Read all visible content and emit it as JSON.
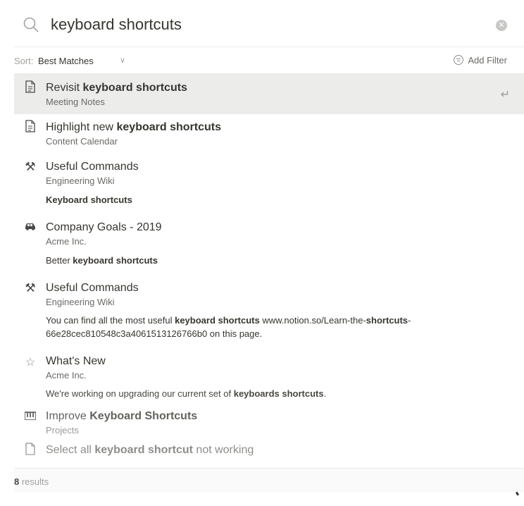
{
  "search": {
    "query": "keyboard shortcuts",
    "clear_icon": "clear-icon"
  },
  "sort": {
    "label": "Sort:",
    "value": "Best Matches",
    "chevron": "∨"
  },
  "filter": {
    "label": "Add Filter"
  },
  "results": [
    {
      "icon": "page-icon",
      "title_pre": "Revisit ",
      "title_bold": "keyboard shortcuts",
      "title_post": "",
      "subtitle": "Meeting Notes",
      "selected": true
    },
    {
      "icon": "page-icon",
      "title_pre": "Highlight new ",
      "title_bold": "keyboard shortcuts",
      "title_post": "",
      "subtitle": "Content Calendar"
    },
    {
      "icon": "hammer-wrench-icon",
      "title_pre": "Useful Commands",
      "subtitle": "Engineering Wiki",
      "snippet_bold": "Keyboard shortcuts"
    },
    {
      "icon": "car-icon",
      "title_pre": "Company Goals - 2019",
      "subtitle": "Acme Inc.",
      "snippet_pre": "Better ",
      "snippet_bold": "keyboard shortcuts"
    },
    {
      "icon": "hammer-wrench-icon",
      "title_pre": "Useful Commands",
      "subtitle": "Engineering Wiki",
      "snippet_pre": "You can find all the most useful ",
      "snippet_bold": "keyboard shortcuts",
      "snippet_mid": " www.notion.so/Learn-the-",
      "snippet_bold2": "shortcuts",
      "snippet_post": "-66e28cec810548c3a4061513126766b0 on this page."
    },
    {
      "icon": "star-icon",
      "title_pre": "What's New",
      "subtitle": "Acme Inc.",
      "snippet_pre": "We're working on upgrading our current set of ",
      "snippet_bold": "keyboards shortcuts",
      "snippet_post": "."
    },
    {
      "icon": "piano-icon",
      "title_pre": "Improve ",
      "title_bold": "Keyboard Shortcuts",
      "subtitle": "Projects"
    },
    {
      "icon": "page-icon",
      "title_pre": "Select all ",
      "title_bold": "keyboard shortcut",
      "title_post": " not working"
    }
  ],
  "footer": {
    "count": "8",
    "label": " results"
  },
  "colors": {
    "selected_bg": "#ececeb",
    "text": "#37352f",
    "muted": "#6b6a66"
  }
}
